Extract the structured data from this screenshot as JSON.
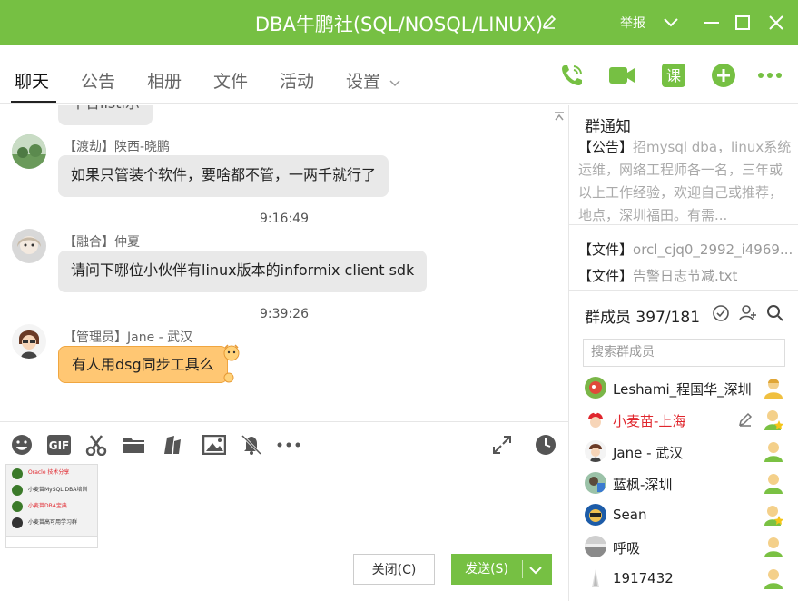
{
  "window": {
    "title": "DBA牛鹏社(SQL/NOSQL/LINUX)",
    "report": "举报",
    "accent": "#76c043"
  },
  "tabs": [
    "聊天",
    "公告",
    "相册",
    "文件",
    "活动",
    "设置"
  ],
  "toolbar_icons": [
    "phone-icon",
    "video-icon",
    "course-icon",
    "add-app-icon",
    "more-icon"
  ],
  "chat": {
    "partial_bubble": "不合listi示",
    "messages": [
      {
        "sender": "【渡劫】陕西-晓鹏",
        "text": "如果只管装个软件，要啥都不管，一两千就行了"
      },
      {
        "time": "9:16:49"
      },
      {
        "sender": "【融合】仲夏",
        "text": "请问下哪位小伙伴有linux版本的informix client sdk"
      },
      {
        "time": "9:39:26"
      },
      {
        "sender": "【管理员】Jane - 武汉",
        "text": "有人用dsg同步工具么"
      }
    ]
  },
  "input_icons": [
    "emoji-icon",
    "gif-icon",
    "scissors-icon",
    "folder-icon",
    "shake-icon",
    "image-icon",
    "bell-off-icon",
    "more-icon",
    "expand-icon",
    "history-clock-icon"
  ],
  "thumbnail": {
    "rows": [
      "Oracle 技术分享",
      "小麦苗MySQL DBA培训",
      "小麦苗DBA宝典",
      "小麦苗高可用学习群"
    ]
  },
  "buttons": {
    "close": "关闭(C)",
    "send": "发送(S)"
  },
  "notice": {
    "title": "群通知",
    "tag": "【公告】",
    "text": "招mysql dba，linux系统运维，网络工程师各一名，三年或以上工作经验，欢迎自己或推荐，地点，深圳福田。有需..."
  },
  "files": [
    {
      "tag": "【文件】",
      "name": "orcl_cjq0_2992_i4969..."
    },
    {
      "tag": "【文件】",
      "name": "告警日志节减.txt"
    }
  ],
  "members": {
    "title": "群成员 397/181",
    "search_placeholder": "搜索群成员",
    "list": [
      {
        "name": "Leshami_程国华_深圳",
        "red": false
      },
      {
        "name": "小麦苗-上海",
        "red": true
      },
      {
        "name": "Jane - 武汉",
        "red": false
      },
      {
        "name": "蓝枫-深圳",
        "red": false
      },
      {
        "name": "Sean",
        "red": false
      },
      {
        "name": "呼吸",
        "red": false
      },
      {
        "name": "1917432",
        "red": false
      }
    ]
  }
}
